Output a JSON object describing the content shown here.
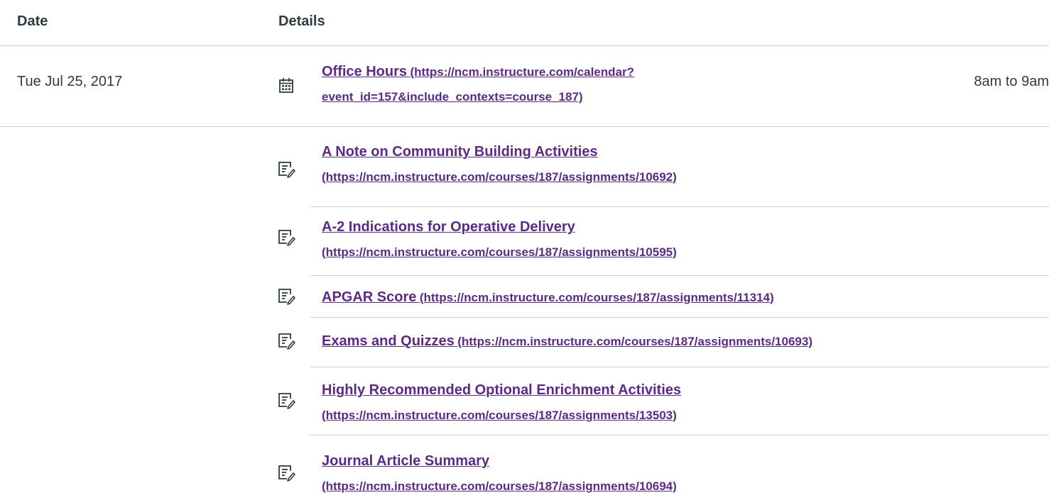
{
  "header": {
    "date_label": "Date",
    "details_label": "Details"
  },
  "event": {
    "date": "Tue Jul 25, 2017",
    "title": "Office Hours",
    "url_line1": "(https://ncm.instructure.com/calendar?",
    "url_line2": "event_id=157&include_contexts=course_187)",
    "time": "8am to 9am",
    "icon": "calendar-icon"
  },
  "assignments": [
    {
      "title": "A Note on Community Building Activities",
      "url": "(https://ncm.instructure.com/courses/187/assignments/10692)",
      "icon": "assignment-icon"
    },
    {
      "title": "A-2 Indications for Operative Delivery",
      "url": "(https://ncm.instructure.com/courses/187/assignments/10595)",
      "icon": "assignment-icon"
    },
    {
      "title": "APGAR Score",
      "url": "(https://ncm.instructure.com/courses/187/assignments/11314)",
      "icon": "assignment-icon"
    },
    {
      "title": "Exams and Quizzes",
      "url": "(https://ncm.instructure.com/courses/187/assignments/10693)",
      "icon": "assignment-icon"
    },
    {
      "title": "Highly Recommended Optional Enrichment Activities",
      "url": "(https://ncm.instructure.com/courses/187/assignments/13503)",
      "icon": "assignment-icon"
    },
    {
      "title": "Journal Article Summary",
      "url": "(https://ncm.instructure.com/courses/187/assignments/10694)",
      "icon": "assignment-icon"
    }
  ],
  "colors": {
    "link": "#5b2a83",
    "text": "#2d3b45",
    "divider": "#c7cdd1"
  }
}
